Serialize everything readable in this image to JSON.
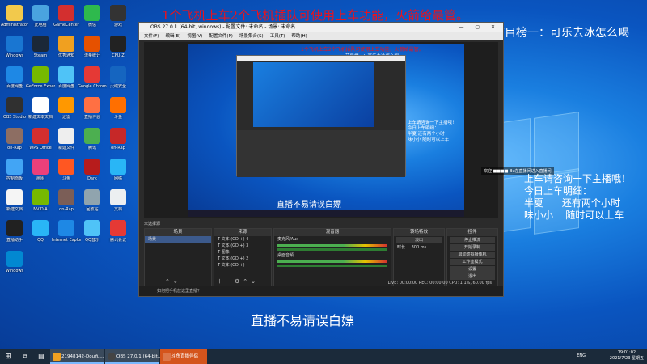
{
  "overlay": {
    "marquee": "1个飞机上车2个飞机插队可使用上车功能，火箭给最管。",
    "top_card": "节目榜一：可乐去冰怎么喝",
    "right_lines": [
      "上车请咨询一下主播哦！",
      "今日上车明细：",
      "半夏      还有两个小时",
      "味小小    随时可以上车"
    ],
    "bottom_text": "直播不易请误白嫖",
    "welcome": "欢迎 ■■■■ Bu在直播间进入直播间"
  },
  "desktop_icons": [
    {
      "label": "Administrator",
      "color": "#f2c94c"
    },
    {
      "label": "此电脑",
      "color": "#4aa3df"
    },
    {
      "label": "GameCenter",
      "color": "#d32f2f"
    },
    {
      "label": "微信",
      "color": "#2eb94d"
    },
    {
      "label": "游戏",
      "color": "#333333"
    },
    {
      "label": "Windows",
      "color": "#1976d2"
    },
    {
      "label": "Steam",
      "color": "#1b2838"
    },
    {
      "label": "优秀通知",
      "color": "#f0a020"
    },
    {
      "label": "流量统计",
      "color": "#e65100"
    },
    {
      "label": "CPU-Z",
      "color": "#222222"
    },
    {
      "label": "百度网盘",
      "color": "#1e88e5"
    },
    {
      "label": "GeForce Experience",
      "color": "#76b900"
    },
    {
      "label": "百度网盘",
      "color": "#4fc3f7"
    },
    {
      "label": "Google Chrome",
      "color": "#e53935"
    },
    {
      "label": "火绒安全",
      "color": "#1565c0"
    },
    {
      "label": "OBS Studio",
      "color": "#303030"
    },
    {
      "label": "新建文本文档",
      "color": "#ffffff"
    },
    {
      "label": "迅雷",
      "color": "#ff9800"
    },
    {
      "label": "直播伴侣",
      "color": "#ff7043"
    },
    {
      "label": "斗鱼",
      "color": "#ff6f00"
    },
    {
      "label": "on-Rap",
      "color": "#8d6e63"
    },
    {
      "label": "WPS Office",
      "color": "#d32f2f"
    },
    {
      "label": "新建文件",
      "color": "#eeeeee"
    },
    {
      "label": "腾讯",
      "color": "#4caf50"
    },
    {
      "label": "on-Rap",
      "color": "#c62828"
    },
    {
      "label": "控制面板",
      "color": "#42a5f5"
    },
    {
      "label": "画图",
      "color": "#ec407a"
    },
    {
      "label": "斗鱼",
      "color": "#ff5722"
    },
    {
      "label": "Dark",
      "color": "#b71c1c"
    },
    {
      "label": "网络",
      "color": "#29b6f6"
    },
    {
      "label": "新建文档",
      "color": "#f5f5f5"
    },
    {
      "label": "NVIDIA",
      "color": "#76b900"
    },
    {
      "label": "on-Rap",
      "color": "#7b5e57"
    },
    {
      "label": "回收站",
      "color": "#90a4ae"
    },
    {
      "label": "文档",
      "color": "#eceff1"
    },
    {
      "label": "直播助手",
      "color": "#212121"
    },
    {
      "label": "QQ",
      "color": "#29b6f6"
    },
    {
      "label": "Internet Explorer",
      "color": "#1e88e5"
    },
    {
      "label": "QQ音乐",
      "color": "#4fc3f7"
    },
    {
      "label": "腾讯会议",
      "color": "#e53935"
    },
    {
      "label": "Windows",
      "color": "#0288d1"
    }
  ],
  "obs": {
    "title": "OBS 27.0.1 (64-bit, windows) - 配置文件: 未命名 - 场景: 未命名",
    "window_controls": "— ▢ ✕",
    "menu": [
      "文件(F)",
      "编辑(E)",
      "视图(V)",
      "配置文件(P)",
      "场景集合(S)",
      "工具(T)",
      "帮助(H)"
    ],
    "preview_caption": "直播不易请误白嫖",
    "scene_bar": "未选择源",
    "docks": {
      "scenes": {
        "title": "场景",
        "items": [
          "场景"
        ]
      },
      "sources": {
        "title": "来源",
        "items": [
          "文本 (GDI+) 4",
          "文本 (GDI+) 3",
          "图像",
          "文本 (GDI+) 2",
          "文本 (GDI+)"
        ]
      },
      "mixer": {
        "title": "混音器",
        "items": [
          "麦克风/Aux",
          "桌面音频"
        ]
      },
      "transitions": {
        "title": "转场特效",
        "fade": "淡出",
        "duration_label": "时长",
        "duration": "300 ms"
      },
      "controls": {
        "title": "控件",
        "buttons": [
          "停止推流",
          "开始录制",
          "启动虚拟摄像机",
          "工作室模式",
          "设置",
          "退出"
        ]
      }
    },
    "status": "LIVE: 00:00:00   REC: 00:00:00   CPU: 1.1%, 60.00 fps",
    "notice": "如何把手机放这里直播？"
  },
  "taskbar": {
    "items": [
      "21948142-DouYu...",
      "OBS 27.0.1 (64-bit...",
      "斗鱼直播伴侣"
    ],
    "lang": "ENG",
    "time": "19:01:02",
    "date": "2021/7/23 星期五"
  }
}
